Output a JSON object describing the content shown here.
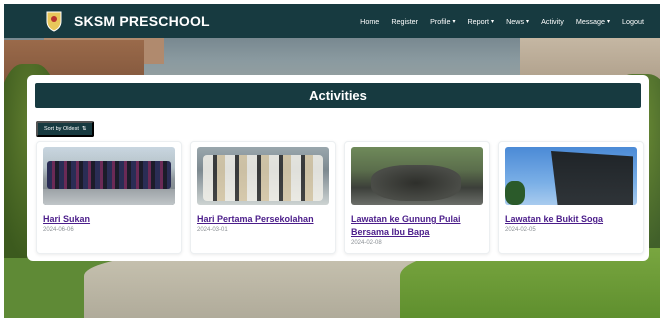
{
  "brand": {
    "name": "SKSM PRESCHOOL",
    "logo_icon": "crest-icon"
  },
  "nav": [
    {
      "label": "Home",
      "dropdown": false
    },
    {
      "label": "Register",
      "dropdown": false
    },
    {
      "label": "Profile",
      "dropdown": true
    },
    {
      "label": "Report",
      "dropdown": true
    },
    {
      "label": "News",
      "dropdown": true
    },
    {
      "label": "Activity",
      "dropdown": false
    },
    {
      "label": "Message",
      "dropdown": true
    },
    {
      "label": "Logout",
      "dropdown": false
    }
  ],
  "page": {
    "title": "Activities"
  },
  "sort": {
    "label": "Sort by Oldest",
    "icon": "sort-icon"
  },
  "activities": [
    {
      "title": "Hari Sukan",
      "date": "2024-06-06"
    },
    {
      "title": "Hari Pertama Persekolahan",
      "date": "2024-03-01"
    },
    {
      "title": "Lawatan ke Gunung Pulai Bersama Ibu Bapa",
      "date": "2024-02-08"
    },
    {
      "title": "Lawatan ke Bukit Soga",
      "date": "2024-02-05"
    }
  ],
  "colors": {
    "primary": "#173a40",
    "link": "#4b1d8a",
    "date": "#8a8f94"
  }
}
